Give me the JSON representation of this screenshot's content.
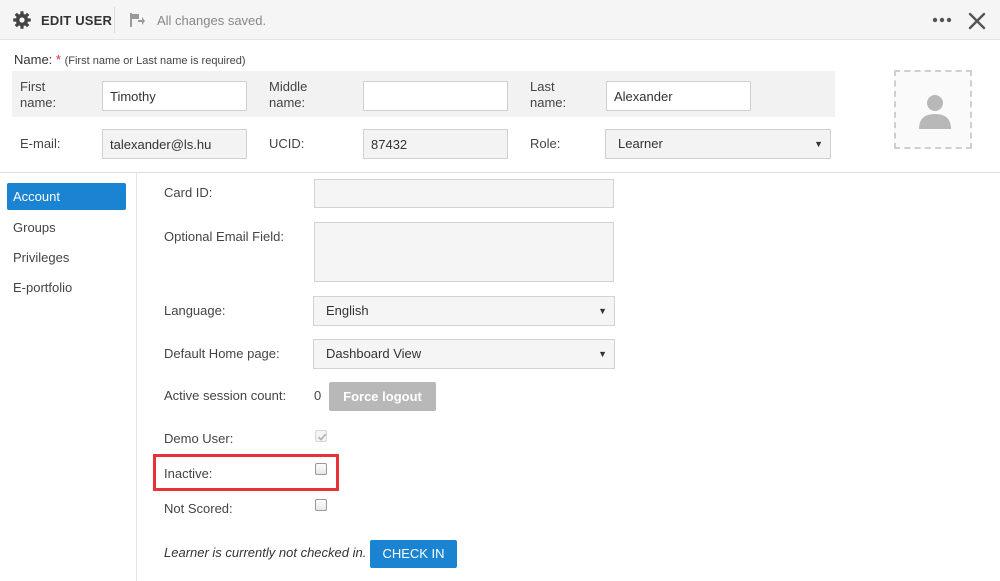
{
  "header": {
    "title": "EDIT USER",
    "status": "All changes saved.",
    "icons": {
      "settings": "gear-icon",
      "save": "save-flag-icon",
      "more": "more-dots-icon",
      "close": "close-icon"
    }
  },
  "name_section": {
    "label": "Name:",
    "required_mark": "*",
    "hint": "(First name or Last name is required)",
    "first_name": {
      "label": "First name:",
      "value": "Timothy"
    },
    "middle_name": {
      "label": "Middle name:",
      "value": ""
    },
    "last_name": {
      "label": "Last name:",
      "value": "Alexander"
    },
    "email": {
      "label": "E-mail:",
      "value": "talexander@ls.hu"
    },
    "ucid": {
      "label": "UCID:",
      "value": "87432"
    },
    "role": {
      "label": "Role:",
      "value": "Learner"
    }
  },
  "sidebar": {
    "items": [
      {
        "label": "Account",
        "active": true
      },
      {
        "label": "Groups",
        "active": false
      },
      {
        "label": "Privileges",
        "active": false
      },
      {
        "label": "E-portfolio",
        "active": false
      }
    ]
  },
  "account": {
    "card_id": {
      "label": "Card ID:",
      "value": ""
    },
    "optional_email": {
      "label": "Optional Email Field:",
      "value": ""
    },
    "language": {
      "label": "Language:",
      "value": "English"
    },
    "home_page": {
      "label": "Default Home page:",
      "value": "Dashboard View"
    },
    "active_session": {
      "label": "Active session count:",
      "count": "0",
      "button": "Force logout"
    },
    "demo_user": {
      "label": "Demo User:",
      "checked": true,
      "disabled": true
    },
    "inactive": {
      "label": "Inactive:",
      "checked": false
    },
    "not_scored": {
      "label": "Not Scored:",
      "checked": false
    },
    "checkin": {
      "text": "Learner is currently not checked in.",
      "button": "CHECK IN"
    }
  },
  "colors": {
    "accent": "#1a83d2",
    "highlight": "#e8323a",
    "required": "#e0262d"
  }
}
